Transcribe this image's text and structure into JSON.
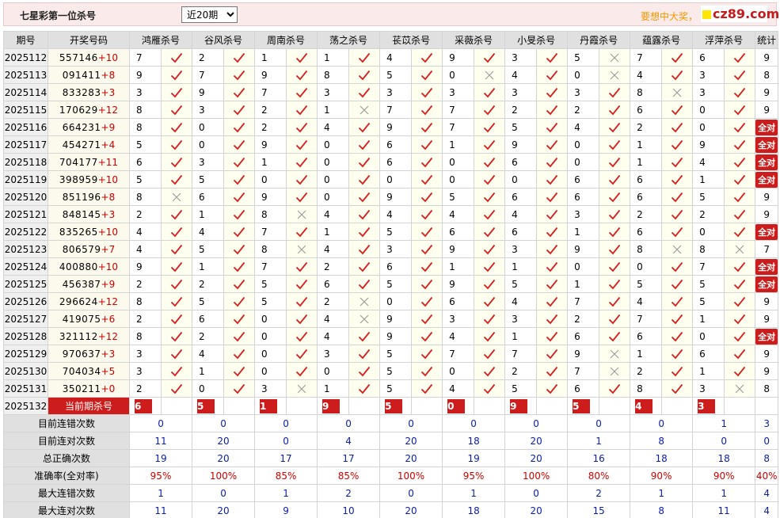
{
  "header": {
    "title": "七星彩第一位杀号",
    "period_select": "近20期",
    "promo": "要想中大奖，",
    "logo": "cz89.com"
  },
  "colors": {
    "check": "#d81e1e",
    "cross": "#999999",
    "badge": "#cc1c1c",
    "stat_blue": "#0a1ea8"
  },
  "columns": {
    "issue": "期号",
    "numbers": "开奖号码",
    "killers": [
      "鸿雁杀号",
      "谷风杀号",
      "周南杀号",
      "荡之杀号",
      "苌苡杀号",
      "采薇杀号",
      "小旻杀号",
      "丹霞杀号",
      "蕴露杀号",
      "浮萍杀号"
    ],
    "total": "统计"
  },
  "rows": [
    {
      "issue": "2025112",
      "nums": "557146",
      "sum": "+10",
      "kills": [
        [
          7,
          1
        ],
        [
          2,
          1
        ],
        [
          1,
          1
        ],
        [
          1,
          1
        ],
        [
          4,
          1
        ],
        [
          9,
          1
        ],
        [
          3,
          1
        ],
        [
          5,
          0
        ],
        [
          7,
          1
        ],
        [
          6,
          1
        ]
      ],
      "total": "9"
    },
    {
      "issue": "2025113",
      "nums": "091411",
      "sum": "+8",
      "kills": [
        [
          9,
          1
        ],
        [
          7,
          1
        ],
        [
          9,
          1
        ],
        [
          8,
          1
        ],
        [
          5,
          1
        ],
        [
          0,
          0
        ],
        [
          4,
          1
        ],
        [
          0,
          0
        ],
        [
          4,
          1
        ],
        [
          3,
          1
        ]
      ],
      "total": "8"
    },
    {
      "issue": "2025114",
      "nums": "833283",
      "sum": "+3",
      "kills": [
        [
          3,
          1
        ],
        [
          9,
          1
        ],
        [
          7,
          1
        ],
        [
          3,
          1
        ],
        [
          3,
          1
        ],
        [
          3,
          1
        ],
        [
          3,
          1
        ],
        [
          3,
          1
        ],
        [
          8,
          0
        ],
        [
          3,
          1
        ]
      ],
      "total": "9"
    },
    {
      "issue": "2025115",
      "nums": "170629",
      "sum": "+12",
      "kills": [
        [
          8,
          1
        ],
        [
          3,
          1
        ],
        [
          2,
          1
        ],
        [
          1,
          0
        ],
        [
          7,
          1
        ],
        [
          7,
          1
        ],
        [
          2,
          1
        ],
        [
          2,
          1
        ],
        [
          6,
          1
        ],
        [
          0,
          1
        ]
      ],
      "total": "9"
    },
    {
      "issue": "2025116",
      "nums": "664231",
      "sum": "+9",
      "kills": [
        [
          8,
          1
        ],
        [
          0,
          1
        ],
        [
          2,
          1
        ],
        [
          4,
          1
        ],
        [
          9,
          1
        ],
        [
          7,
          1
        ],
        [
          5,
          1
        ],
        [
          4,
          1
        ],
        [
          2,
          1
        ],
        [
          0,
          1
        ]
      ],
      "total": "全对"
    },
    {
      "issue": "2025117",
      "nums": "454271",
      "sum": "+4",
      "kills": [
        [
          5,
          1
        ],
        [
          0,
          1
        ],
        [
          9,
          1
        ],
        [
          0,
          1
        ],
        [
          6,
          1
        ],
        [
          1,
          1
        ],
        [
          9,
          1
        ],
        [
          0,
          1
        ],
        [
          1,
          1
        ],
        [
          9,
          1
        ]
      ],
      "total": "全对"
    },
    {
      "issue": "2025118",
      "nums": "704177",
      "sum": "+11",
      "kills": [
        [
          6,
          1
        ],
        [
          3,
          1
        ],
        [
          1,
          1
        ],
        [
          0,
          1
        ],
        [
          6,
          1
        ],
        [
          0,
          1
        ],
        [
          6,
          1
        ],
        [
          0,
          1
        ],
        [
          1,
          1
        ],
        [
          4,
          1
        ]
      ],
      "total": "全对"
    },
    {
      "issue": "2025119",
      "nums": "398959",
      "sum": "+10",
      "kills": [
        [
          5,
          1
        ],
        [
          5,
          1
        ],
        [
          0,
          1
        ],
        [
          0,
          1
        ],
        [
          0,
          1
        ],
        [
          0,
          1
        ],
        [
          0,
          1
        ],
        [
          6,
          1
        ],
        [
          6,
          1
        ],
        [
          1,
          1
        ]
      ],
      "total": "全对"
    },
    {
      "issue": "2025120",
      "nums": "851196",
      "sum": "+8",
      "kills": [
        [
          8,
          0
        ],
        [
          6,
          1
        ],
        [
          9,
          1
        ],
        [
          0,
          1
        ],
        [
          9,
          1
        ],
        [
          5,
          1
        ],
        [
          6,
          1
        ],
        [
          6,
          1
        ],
        [
          6,
          1
        ],
        [
          5,
          1
        ]
      ],
      "total": "9"
    },
    {
      "issue": "2025121",
      "nums": "848145",
      "sum": "+3",
      "kills": [
        [
          2,
          1
        ],
        [
          1,
          1
        ],
        [
          8,
          0
        ],
        [
          4,
          1
        ],
        [
          4,
          1
        ],
        [
          4,
          1
        ],
        [
          4,
          1
        ],
        [
          3,
          1
        ],
        [
          2,
          1
        ],
        [
          2,
          1
        ]
      ],
      "total": "9"
    },
    {
      "issue": "2025122",
      "nums": "835265",
      "sum": "+10",
      "kills": [
        [
          4,
          1
        ],
        [
          4,
          1
        ],
        [
          7,
          1
        ],
        [
          1,
          1
        ],
        [
          5,
          1
        ],
        [
          6,
          1
        ],
        [
          6,
          1
        ],
        [
          1,
          1
        ],
        [
          6,
          1
        ],
        [
          0,
          1
        ]
      ],
      "total": "全对"
    },
    {
      "issue": "2025123",
      "nums": "806579",
      "sum": "+7",
      "kills": [
        [
          4,
          1
        ],
        [
          5,
          1
        ],
        [
          8,
          0
        ],
        [
          4,
          1
        ],
        [
          3,
          1
        ],
        [
          9,
          1
        ],
        [
          3,
          1
        ],
        [
          9,
          1
        ],
        [
          8,
          0
        ],
        [
          8,
          0
        ]
      ],
      "total": "7"
    },
    {
      "issue": "2025124",
      "nums": "400880",
      "sum": "+10",
      "kills": [
        [
          9,
          1
        ],
        [
          1,
          1
        ],
        [
          7,
          1
        ],
        [
          2,
          1
        ],
        [
          6,
          1
        ],
        [
          1,
          1
        ],
        [
          1,
          1
        ],
        [
          0,
          1
        ],
        [
          0,
          1
        ],
        [
          7,
          1
        ]
      ],
      "total": "全对"
    },
    {
      "issue": "2025125",
      "nums": "456387",
      "sum": "+9",
      "kills": [
        [
          2,
          1
        ],
        [
          2,
          1
        ],
        [
          5,
          1
        ],
        [
          6,
          1
        ],
        [
          5,
          1
        ],
        [
          9,
          1
        ],
        [
          5,
          1
        ],
        [
          1,
          1
        ],
        [
          5,
          1
        ],
        [
          5,
          1
        ]
      ],
      "total": "全对"
    },
    {
      "issue": "2025126",
      "nums": "296624",
      "sum": "+12",
      "kills": [
        [
          8,
          1
        ],
        [
          5,
          1
        ],
        [
          5,
          1
        ],
        [
          2,
          0
        ],
        [
          0,
          1
        ],
        [
          6,
          1
        ],
        [
          4,
          1
        ],
        [
          7,
          1
        ],
        [
          4,
          1
        ],
        [
          5,
          1
        ]
      ],
      "total": "9"
    },
    {
      "issue": "2025127",
      "nums": "419075",
      "sum": "+6",
      "kills": [
        [
          2,
          1
        ],
        [
          6,
          1
        ],
        [
          0,
          1
        ],
        [
          4,
          0
        ],
        [
          9,
          1
        ],
        [
          3,
          1
        ],
        [
          3,
          1
        ],
        [
          2,
          1
        ],
        [
          7,
          1
        ],
        [
          1,
          1
        ]
      ],
      "total": "9"
    },
    {
      "issue": "2025128",
      "nums": "321112",
      "sum": "+12",
      "kills": [
        [
          8,
          1
        ],
        [
          2,
          1
        ],
        [
          0,
          1
        ],
        [
          4,
          1
        ],
        [
          9,
          1
        ],
        [
          4,
          1
        ],
        [
          1,
          1
        ],
        [
          6,
          1
        ],
        [
          6,
          1
        ],
        [
          0,
          1
        ]
      ],
      "total": "全对"
    },
    {
      "issue": "2025129",
      "nums": "970637",
      "sum": "+3",
      "kills": [
        [
          3,
          1
        ],
        [
          4,
          1
        ],
        [
          0,
          1
        ],
        [
          3,
          1
        ],
        [
          5,
          1
        ],
        [
          7,
          1
        ],
        [
          7,
          1
        ],
        [
          9,
          0
        ],
        [
          1,
          1
        ],
        [
          6,
          1
        ]
      ],
      "total": "9"
    },
    {
      "issue": "2025130",
      "nums": "704034",
      "sum": "+5",
      "kills": [
        [
          3,
          1
        ],
        [
          1,
          1
        ],
        [
          0,
          1
        ],
        [
          0,
          1
        ],
        [
          5,
          1
        ],
        [
          0,
          1
        ],
        [
          2,
          1
        ],
        [
          7,
          0
        ],
        [
          2,
          1
        ],
        [
          1,
          1
        ]
      ],
      "total": "9"
    },
    {
      "issue": "2025131",
      "nums": "350211",
      "sum": "+0",
      "kills": [
        [
          2,
          1
        ],
        [
          0,
          1
        ],
        [
          3,
          0
        ],
        [
          1,
          1
        ],
        [
          5,
          1
        ],
        [
          4,
          1
        ],
        [
          5,
          1
        ],
        [
          6,
          1
        ],
        [
          8,
          1
        ],
        [
          3,
          0
        ]
      ],
      "total": "8"
    }
  ],
  "current": {
    "issue": "2025132",
    "label": "当前期杀号",
    "kills": [
      "6",
      "5",
      "1",
      "9",
      "5",
      "0",
      "9",
      "5",
      "4",
      "3"
    ]
  },
  "stats": [
    {
      "label": "目前连错次数",
      "values": [
        "0",
        "0",
        "0",
        "0",
        "0",
        "0",
        "0",
        "0",
        "0",
        "1"
      ],
      "total": "3",
      "color": "blue"
    },
    {
      "label": "目前连对次数",
      "values": [
        "11",
        "20",
        "0",
        "4",
        "20",
        "18",
        "20",
        "1",
        "8",
        "0"
      ],
      "total": "0",
      "color": "blue"
    },
    {
      "label": "总正确次数",
      "values": [
        "19",
        "20",
        "17",
        "17",
        "20",
        "19",
        "20",
        "16",
        "18",
        "18"
      ],
      "total": "8",
      "color": "blue"
    },
    {
      "label": "准确率(全对率)",
      "values": [
        "95%",
        "100%",
        "85%",
        "85%",
        "100%",
        "95%",
        "100%",
        "80%",
        "90%",
        "90%"
      ],
      "total": "40%",
      "color": "red"
    },
    {
      "label": "最大连错次数",
      "values": [
        "1",
        "0",
        "1",
        "2",
        "0",
        "1",
        "0",
        "2",
        "1",
        "1"
      ],
      "total": "4",
      "color": "blue"
    },
    {
      "label": "最大连对次数",
      "values": [
        "11",
        "20",
        "9",
        "10",
        "20",
        "18",
        "20",
        "15",
        "8",
        "11"
      ],
      "total": "4",
      "color": "blue"
    }
  ]
}
